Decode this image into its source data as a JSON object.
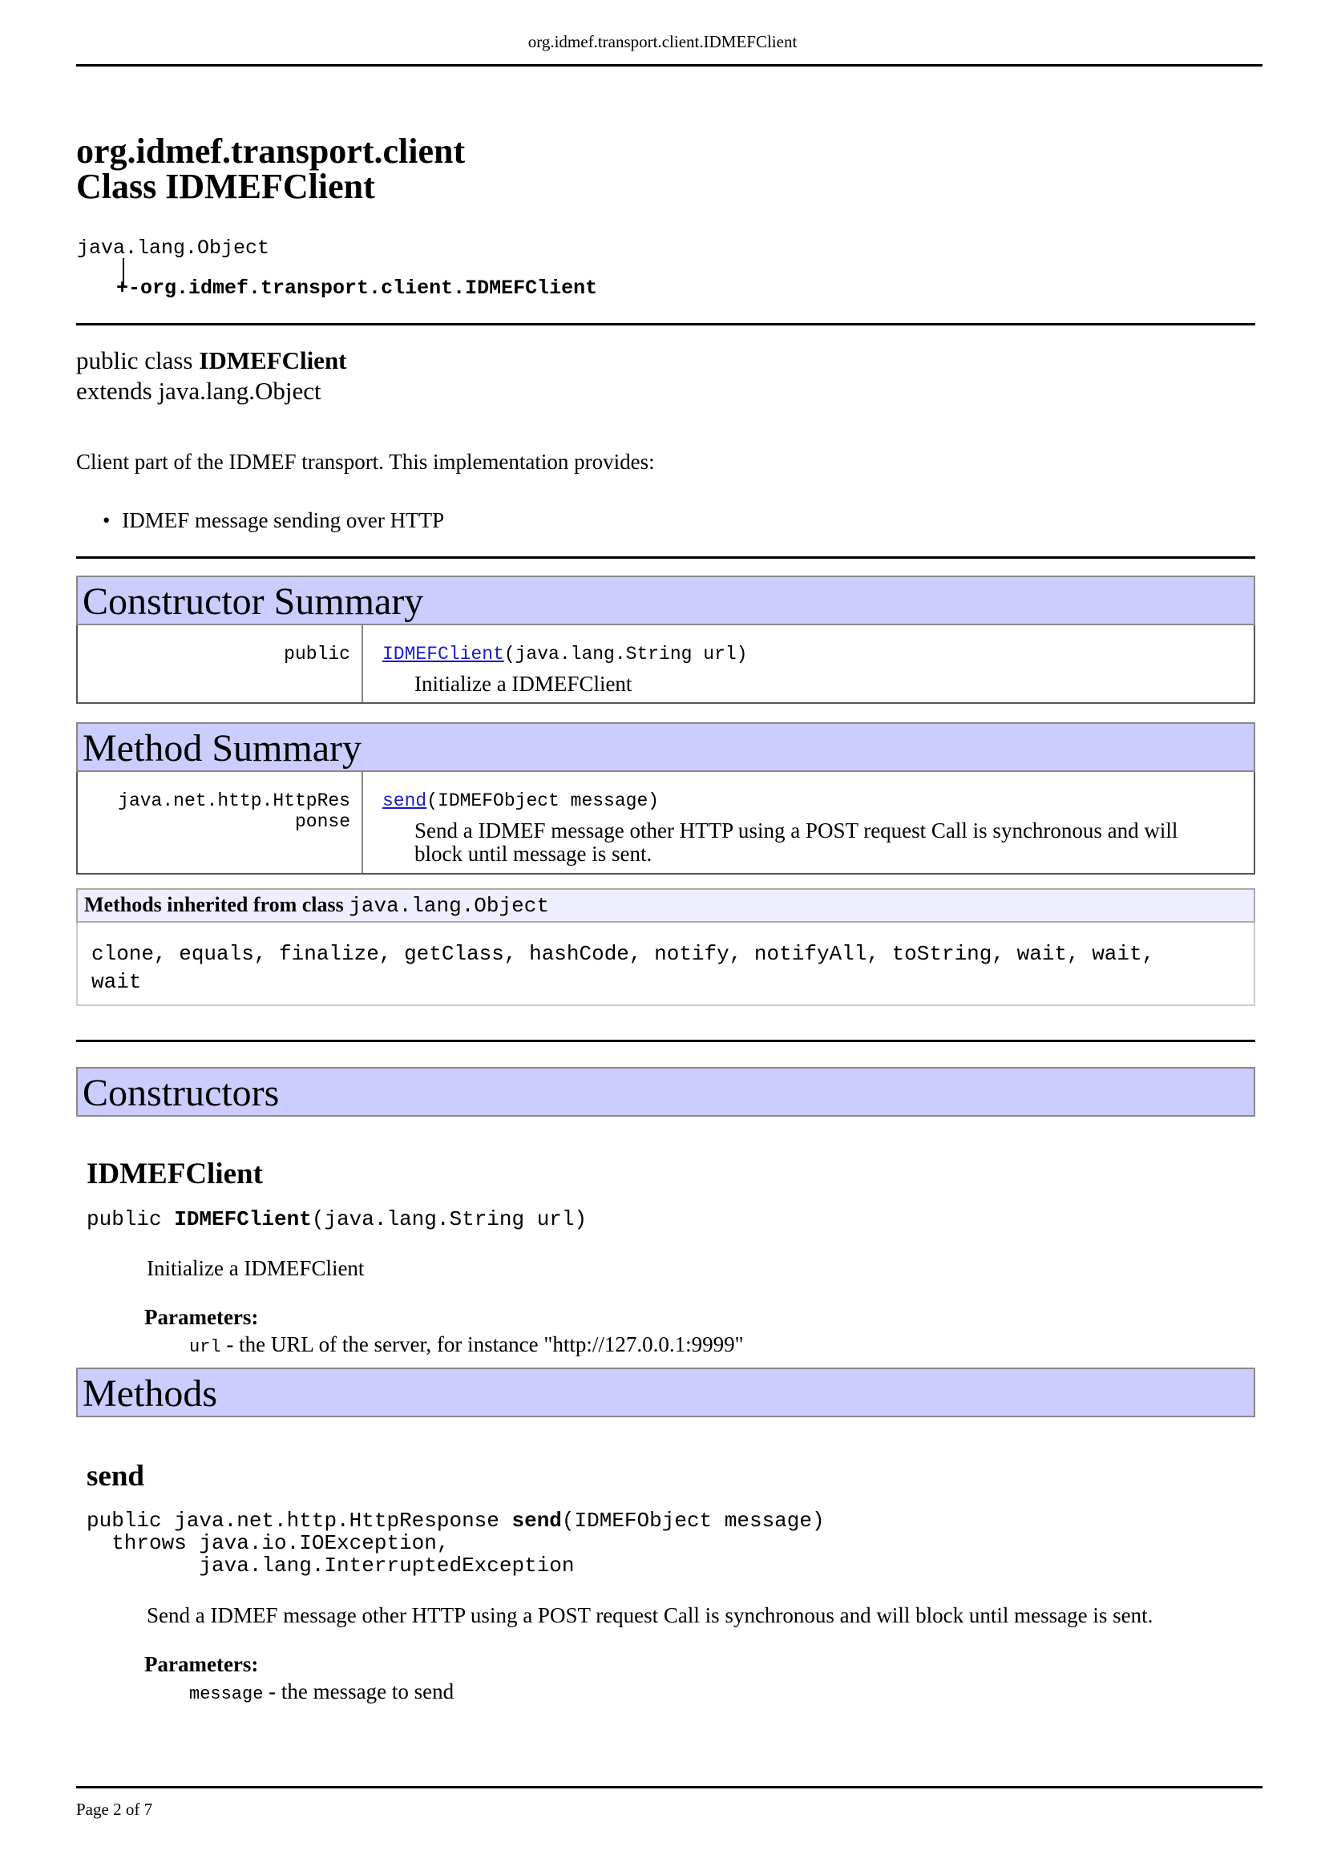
{
  "header": {
    "running_title": "org.idmef.transport.client.IDMEFClient"
  },
  "title": {
    "package": "org.idmef.transport.client",
    "class_line": "Class IDMEFClient"
  },
  "hierarchy": {
    "parent": "java.lang.Object",
    "child": "org.idmef.transport.client.IDMEFClient",
    "connector": "+-"
  },
  "declaration": {
    "prefix": "public class ",
    "name": "IDMEFClient",
    "extends_line": "extends java.lang.Object"
  },
  "description": {
    "text": "Client part of the IDMEF transport. This implementation provides:",
    "bullets": [
      "IDMEF message sending over HTTP"
    ]
  },
  "constructor_summary": {
    "heading": "Constructor Summary",
    "rows": [
      {
        "modifier": "public",
        "name": "IDMEFClient",
        "params": "(java.lang.String url)",
        "desc": "Initialize a IDMEFClient"
      }
    ]
  },
  "method_summary": {
    "heading": "Method Summary",
    "rows": [
      {
        "return_type_line1": "java.net.http.HttpRes",
        "return_type_line2": "ponse",
        "name": "send",
        "params": "(IDMEFObject message)",
        "desc_line1": "Send a IDMEF message other HTTP using a POST request Call is synchronous and will",
        "desc_line2": "block until message is sent."
      }
    ]
  },
  "inherited": {
    "heading_prefix": "Methods inherited from class ",
    "heading_class": "java.lang.Object",
    "line1": "clone, equals, finalize, getClass, hashCode, notify, notifyAll, toString, wait, wait,",
    "line2": "wait"
  },
  "constructors_detail": {
    "heading": "Constructors",
    "name": "IDMEFClient",
    "sig_prefix": "public ",
    "sig_name": "IDMEFClient",
    "sig_params": "(java.lang.String url)",
    "desc": "Initialize a IDMEFClient",
    "params_label": "Parameters:",
    "param_name": "url",
    "param_desc": " - the URL of the server, for instance \"http://127.0.0.1:9999\""
  },
  "methods_detail": {
    "heading": "Methods",
    "name": "send",
    "sig_prefix": "public java.net.http.HttpResponse ",
    "sig_name": "send",
    "sig_params": "(IDMEFObject message)",
    "throws_line1": "  throws java.io.IOException,",
    "throws_line2": "         java.lang.InterruptedException",
    "desc": "Send a IDMEF message other HTTP using a POST request Call is synchronous and will block until message is sent.",
    "params_label": "Parameters:",
    "param_name": "message",
    "param_desc": " - the message to send"
  },
  "footer": {
    "page": "Page 2 of 7"
  }
}
